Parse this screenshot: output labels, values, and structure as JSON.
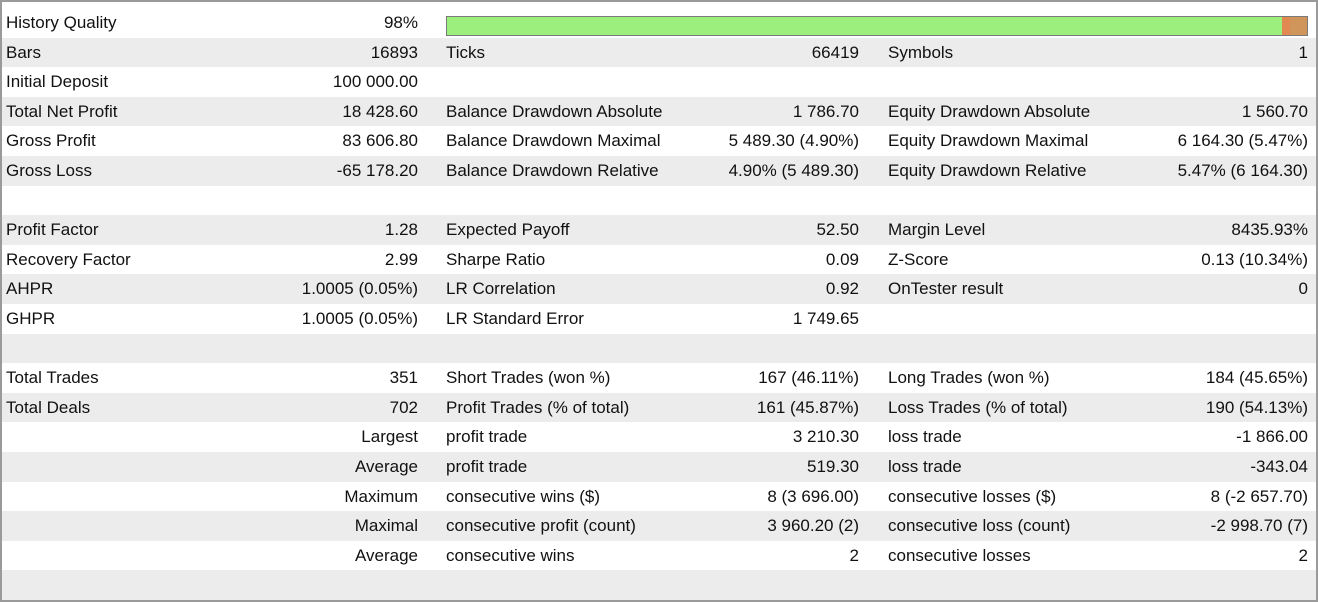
{
  "history_quality": {
    "label": "History Quality",
    "value": "98%",
    "fill": 0.98
  },
  "colors": {
    "quality_good": "#9cef7d",
    "quality_bad": "#d0955a",
    "row_shade": "#ececec"
  },
  "rows": [
    {
      "k1": "Bars",
      "v1": "16893",
      "k2": "Ticks",
      "v2": "66419",
      "k3": "Symbols",
      "v3": "1"
    },
    {
      "k1": "Initial Deposit",
      "v1": "100 000.00"
    },
    {
      "k1": "Total Net Profit",
      "v1": "18 428.60",
      "k2": "Balance Drawdown Absolute",
      "v2": "1 786.70",
      "k3": "Equity Drawdown Absolute",
      "v3": "1 560.70"
    },
    {
      "k1": "Gross Profit",
      "v1": "83 606.80",
      "k2": "Balance Drawdown Maximal",
      "v2": "5 489.30 (4.90%)",
      "k3": "Equity Drawdown Maximal",
      "v3": "6 164.30 (5.47%)"
    },
    {
      "k1": "Gross Loss",
      "v1": "-65 178.20",
      "k2": "Balance Drawdown Relative",
      "v2": "4.90% (5 489.30)",
      "k3": "Equity Drawdown Relative",
      "v3": "5.47% (6 164.30)"
    },
    {},
    {
      "k1": "Profit Factor",
      "v1": "1.28",
      "k2": "Expected Payoff",
      "v2": "52.50",
      "k3": "Margin Level",
      "v3": "8435.93%"
    },
    {
      "k1": "Recovery Factor",
      "v1": "2.99",
      "k2": "Sharpe Ratio",
      "v2": "0.09",
      "k3": "Z-Score",
      "v3": "0.13 (10.34%)"
    },
    {
      "k1": "AHPR",
      "v1": "1.0005 (0.05%)",
      "k2": "LR Correlation",
      "v2": "0.92",
      "k3": "OnTester result",
      "v3": "0"
    },
    {
      "k1": "GHPR",
      "v1": "1.0005 (0.05%)",
      "k2": "LR Standard Error",
      "v2": "1 749.65"
    },
    {},
    {
      "k1": "Total Trades",
      "v1": "351",
      "k2": "Short Trades (won %)",
      "v2": "167 (46.11%)",
      "k3": "Long Trades (won %)",
      "v3": "184 (45.65%)"
    },
    {
      "k1": "Total Deals",
      "v1": "702",
      "k2": "Profit Trades (% of total)",
      "v2": "161 (45.87%)",
      "k3": "Loss Trades (% of total)",
      "v3": "190 (54.13%)"
    },
    {
      "r1": "Largest",
      "k2": "profit trade",
      "v2": "3 210.30",
      "k3": "loss trade",
      "v3": "-1 866.00"
    },
    {
      "r1": "Average",
      "k2": "profit trade",
      "v2": "519.30",
      "k3": "loss trade",
      "v3": "-343.04"
    },
    {
      "r1": "Maximum",
      "k2": "consecutive wins ($)",
      "v2": "8 (3 696.00)",
      "k3": "consecutive losses ($)",
      "v3": "8 (-2 657.70)"
    },
    {
      "r1": "Maximal",
      "k2": "consecutive profit (count)",
      "v2": "3 960.20 (2)",
      "k3": "consecutive loss (count)",
      "v3": "-2 998.70 (7)"
    },
    {
      "r1": "Average",
      "k2": "consecutive wins",
      "v2": "2",
      "k3": "consecutive losses",
      "v3": "2"
    },
    {}
  ]
}
